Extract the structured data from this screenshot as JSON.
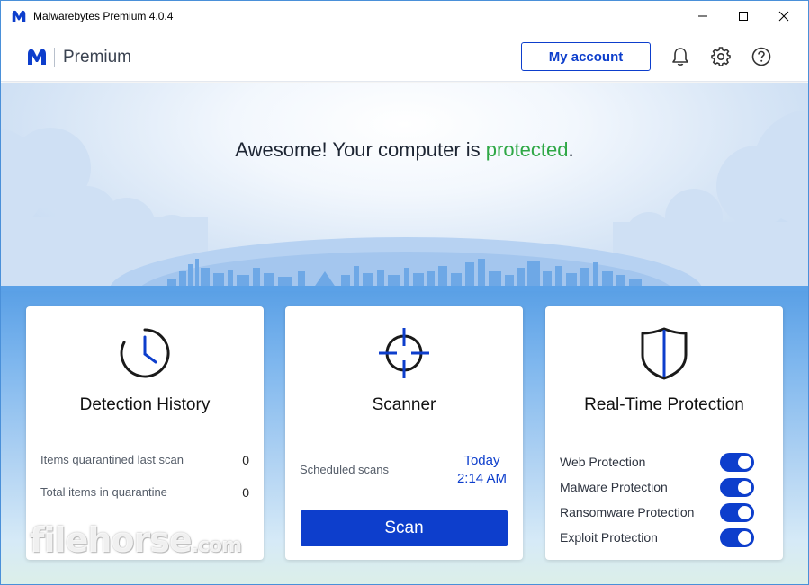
{
  "window": {
    "title": "Malwarebytes Premium  4.0.4",
    "controls": [
      "minimize-icon",
      "maximize-icon",
      "close-icon"
    ]
  },
  "header": {
    "product": "Premium",
    "account_button": "My account",
    "icons": [
      "bell-icon",
      "gear-icon",
      "help-icon"
    ]
  },
  "hero": {
    "headline_prefix": "Awesome! Your computer is ",
    "headline_status": "protected",
    "headline_suffix": ".",
    "status_color": "#2fa846"
  },
  "cards": {
    "detection": {
      "title": "Detection History",
      "icon": "clock-icon",
      "rows": [
        {
          "label": "Items quarantined last scan",
          "value": "0"
        },
        {
          "label": "Total items in quarantine",
          "value": "0"
        }
      ]
    },
    "scanner": {
      "title": "Scanner",
      "icon": "crosshair-icon",
      "scheduled_label": "Scheduled scans",
      "scheduled_day": "Today",
      "scheduled_time": "2:14 AM",
      "scan_button": "Scan"
    },
    "realtime": {
      "title": "Real-Time Protection",
      "icon": "shield-icon",
      "items": [
        {
          "label": "Web Protection",
          "enabled": true
        },
        {
          "label": "Malware Protection",
          "enabled": true
        },
        {
          "label": "Ransomware Protection",
          "enabled": true
        },
        {
          "label": "Exploit Protection",
          "enabled": true
        }
      ]
    }
  },
  "colors": {
    "accent": "#0d3ecc",
    "protected": "#2fa846"
  },
  "watermark": {
    "name": "filehorse",
    "domain": ".com"
  }
}
